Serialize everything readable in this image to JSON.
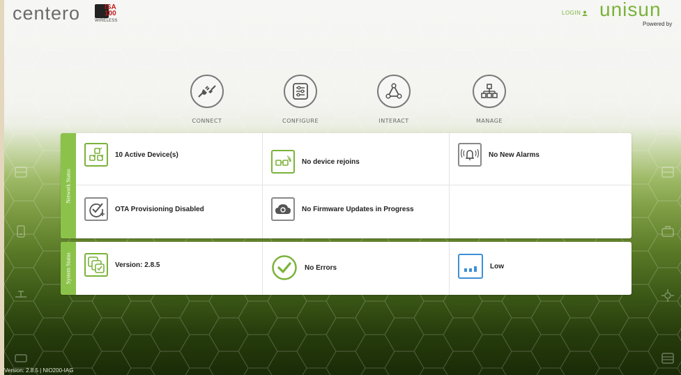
{
  "header": {
    "brand": "centero",
    "partner_top": "ISA",
    "partner_num": "100",
    "partner_sub": "WIRELESS",
    "login_label": "LOGIN",
    "product": "unisun",
    "powered_by": "Powered by"
  },
  "nav": [
    {
      "label": "CONNECT",
      "icon": "plug-icon"
    },
    {
      "label": "CONFIGURE",
      "icon": "sliders-icon"
    },
    {
      "label": "INTERACT",
      "icon": "network-triangle-icon"
    },
    {
      "label": "MANAGE",
      "icon": "hierarchy-icon"
    }
  ],
  "network_status": {
    "tab_label": "Network Status",
    "items": [
      {
        "text": "10 Active Device(s)",
        "icon": "devices-icon"
      },
      {
        "text": "No device rejoins",
        "icon": "rejoin-icon"
      },
      {
        "text": "No New Alarms",
        "icon": "alarm-icon"
      },
      {
        "text": "OTA Provisioning Disabled",
        "icon": "ota-provisioning-icon"
      },
      {
        "text": "No Firmware Updates in Progress",
        "icon": "cloud-sync-icon"
      }
    ]
  },
  "system_status": {
    "tab_label": "System Status",
    "items": [
      {
        "text": "Version: 2.8.5",
        "icon": "version-icon"
      },
      {
        "text": "No Errors",
        "icon": "check-circle-icon"
      },
      {
        "text": "Low",
        "icon": "signal-bars-icon"
      }
    ]
  },
  "footer": {
    "version": "Version: 2.8.5 | NIO200-IAG"
  },
  "colors": {
    "accent": "#7bb23a",
    "tab_green": "#8bc34a",
    "blue": "#3d8fd6"
  }
}
